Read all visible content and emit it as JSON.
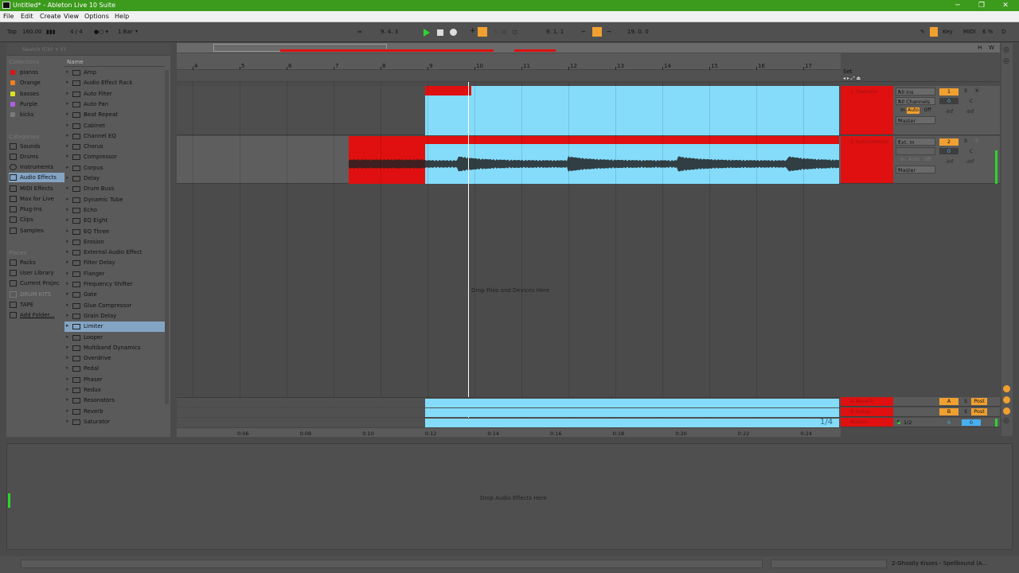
{
  "window": {
    "title": "Untitled* - Ableton Live 10 Suite",
    "minimize": "─",
    "maximize": "❐",
    "close": "✕"
  },
  "menu": [
    "File",
    "Edit",
    "Create",
    "View",
    "Options",
    "Help"
  ],
  "control_bar": {
    "tap": "Tap",
    "tempo": "160.00",
    "time_sig": "4 / 4",
    "quantize": "1 Bar",
    "position": "9.  4.  3",
    "loop_start": "9.  1.  1",
    "loop_length": "19.  0.  0",
    "key": "Key",
    "midi": "MIDI",
    "cpu": "6 %",
    "disk": "D"
  },
  "browser": {
    "search_placeholder": "Search (Ctrl + F)",
    "collections_title": "Collections",
    "collections": [
      {
        "label": "pianos",
        "color": "#e01010"
      },
      {
        "label": "Orange",
        "color": "#f08020"
      },
      {
        "label": "basses",
        "color": "#e0e020"
      },
      {
        "label": "Purple",
        "color": "#b060e0"
      },
      {
        "label": "kicks",
        "color": "#7a7a7a"
      }
    ],
    "categories_title": "Categories",
    "categories": [
      "Sounds",
      "Drums",
      "Instruments",
      "Audio Effects",
      "MIDI Effects",
      "Max for Live",
      "Plug-Ins",
      "Clips",
      "Samples"
    ],
    "selected_category": "Audio Effects",
    "places_title": "Places",
    "places": [
      "Packs",
      "User Library",
      "Current Projec",
      "DRUM KITS",
      "TAPE",
      "Add Folder..."
    ],
    "list_header": "Name",
    "items": [
      "Amp",
      "Audio Effect Rack",
      "Auto Filter",
      "Auto Pan",
      "Beat Repeat",
      "Cabinet",
      "Channel EQ",
      "Chorus",
      "Compressor",
      "Corpus",
      "Delay",
      "Drum Buss",
      "Dynamic Tube",
      "Echo",
      "EQ Eight",
      "EQ Three",
      "Erosion",
      "External Audio Effect",
      "Filter Delay",
      "Flanger",
      "Frequency Shifter",
      "Gate",
      "Glue Compressor",
      "Grain Delay",
      "Limiter",
      "Looper",
      "Multiband Dynamics",
      "Overdrive",
      "Pedal",
      "Phaser",
      "Redux",
      "Resonators",
      "Reverb",
      "Saturator"
    ],
    "selected_item": "Limiter"
  },
  "arrangement": {
    "bar_numbers": [
      "4",
      "5",
      "6",
      "7",
      "8",
      "9",
      "10",
      "11",
      "12",
      "13",
      "14",
      "15",
      "16",
      "17"
    ],
    "set_label": "Set",
    "drop_files": "Drop Files and Devices Here",
    "time_labels": [
      "0:06",
      "0:08",
      "0:10",
      "0:12",
      "0:14",
      "0:16",
      "0:18",
      "0:20",
      "0:22",
      "0:24"
    ],
    "zoom_fraction": "1/4"
  },
  "tracks": [
    {
      "name": "1 Operator",
      "input": "All Ins",
      "channel": "All Channels",
      "output": "Master",
      "num": "1",
      "solo": "S",
      "vol": "0",
      "pan": "C",
      "monitor": [
        "In",
        "Auto",
        "Off"
      ],
      "meters": [
        "-inf",
        "-inf"
      ]
    },
    {
      "name": "2 Instrumental",
      "input": "Ext. In",
      "channel": "",
      "output": "Master",
      "num": "2",
      "solo": "S",
      "vol": "0",
      "pan": "C",
      "monitor": [
        "In",
        "Auto",
        "Off"
      ],
      "meters": [
        "-inf",
        "-inf"
      ]
    }
  ],
  "returns": [
    {
      "name": "A Reverb",
      "letter": "A",
      "solo": "S",
      "post": "Post"
    },
    {
      "name": "B Delay",
      "letter": "B",
      "solo": "S",
      "post": "Post"
    }
  ],
  "master": {
    "name": "Master",
    "cue": "1/2",
    "vol": "0",
    "pan": "0"
  },
  "detail": {
    "drop_audio": "Drop Audio Effects Here"
  },
  "status": {
    "selected_track": "2-Ghostly Kisses - Spellbound (A..."
  }
}
